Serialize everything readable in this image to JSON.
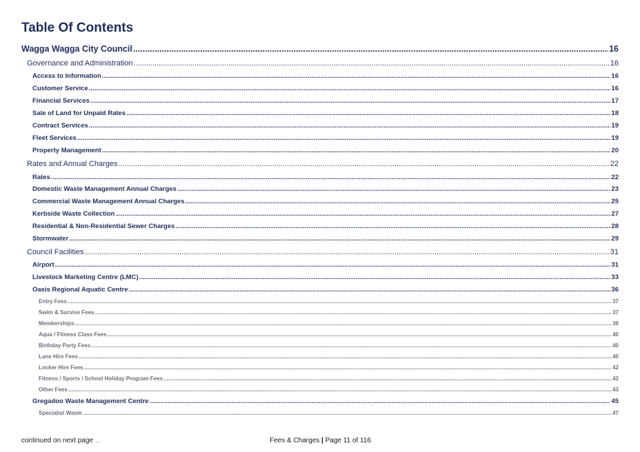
{
  "title": "Table Of Contents",
  "entries": [
    {
      "level": 1,
      "label": "Wagga Wagga City Council",
      "page": "16"
    },
    {
      "level": 2,
      "label": "Governance and Administration",
      "page": "16"
    },
    {
      "level": 3,
      "label": "Access to Information",
      "page": "16"
    },
    {
      "level": 3,
      "label": "Customer Service",
      "page": "16"
    },
    {
      "level": 3,
      "label": "Financial Services",
      "page": "17"
    },
    {
      "level": 3,
      "label": "Sale of Land for Unpaid Rates",
      "page": "18"
    },
    {
      "level": 3,
      "label": "Contract Services",
      "page": "19"
    },
    {
      "level": 3,
      "label": "Fleet Services",
      "page": "19"
    },
    {
      "level": 3,
      "label": "Property Management",
      "page": "20"
    },
    {
      "level": 2,
      "label": "Rates and Annual Charges",
      "page": "22"
    },
    {
      "level": 3,
      "label": "Rates",
      "page": "22"
    },
    {
      "level": 3,
      "label": "Domestic Waste Management Annual Charges",
      "page": "23"
    },
    {
      "level": 3,
      "label": "Commercial Waste Management Annual Charges",
      "page": "25"
    },
    {
      "level": 3,
      "label": "Kerbside Waste Collection",
      "page": "27"
    },
    {
      "level": 3,
      "label": "Residential & Non-Residential Sewer Charges",
      "page": "28"
    },
    {
      "level": 3,
      "label": "Stormwater",
      "page": "29"
    },
    {
      "level": 2,
      "label": "Council Facilities",
      "page": "31"
    },
    {
      "level": 3,
      "label": "Airport",
      "page": "31"
    },
    {
      "level": 3,
      "label": "Livestock Marketing Centre (LMC)",
      "page": "33"
    },
    {
      "level": 3,
      "label": "Oasis Regional Aquatic Centre",
      "page": "36"
    },
    {
      "level": 4,
      "label": "Entry Fees",
      "page": "37"
    },
    {
      "level": 4,
      "label": "Swim & Survive Fees",
      "page": "37"
    },
    {
      "level": 4,
      "label": "Memberships",
      "page": "38"
    },
    {
      "level": 4,
      "label": "Aqua / Fitness Class Fees",
      "page": "40"
    },
    {
      "level": 4,
      "label": "Birthday Party Fees",
      "page": "40"
    },
    {
      "level": 4,
      "label": "Lane Hire Fees",
      "page": "40"
    },
    {
      "level": 4,
      "label": "Locker Hire Fees",
      "page": "42"
    },
    {
      "level": 4,
      "label": "Fitness / Sports / School Holiday Program Fees",
      "page": "42"
    },
    {
      "level": 4,
      "label": "Other Fees",
      "page": "43"
    },
    {
      "level": 3,
      "label": "Gregadoo Waste Management Centre",
      "page": "45"
    },
    {
      "level": 4,
      "label": "Specialist Waste",
      "page": "47"
    }
  ],
  "footer": {
    "continued": "continued on next page",
    "ellipsis": "...",
    "doc_name": "Fees & Charges",
    "separator": "|",
    "page_label": "Page 11 of 116"
  }
}
